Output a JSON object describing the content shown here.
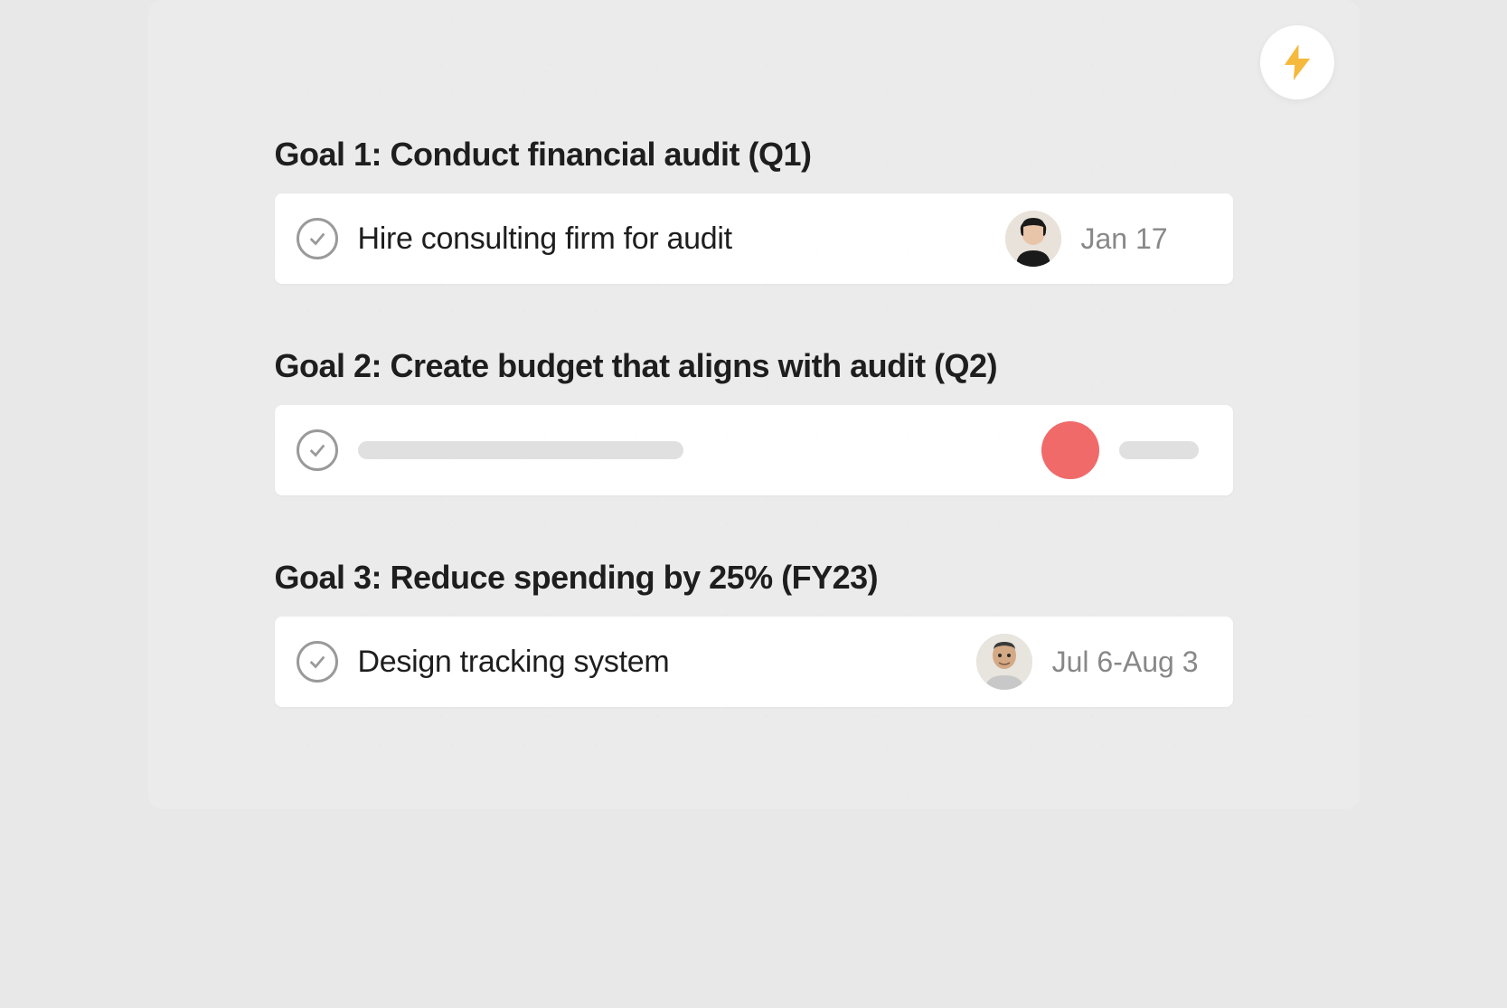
{
  "goals": [
    {
      "title": "Goal 1: Conduct financial audit (Q1)",
      "task": {
        "title": "Hire consulting firm for audit",
        "date": "Jan 17",
        "has_content": true,
        "status_color": null
      }
    },
    {
      "title": "Goal 2: Create budget that aligns with audit (Q2)",
      "task": {
        "title": "",
        "date": "",
        "has_content": false,
        "status_color": "#f06a6a"
      }
    },
    {
      "title": "Goal 3: Reduce spending by 25% (FY23)",
      "task": {
        "title": "Design tracking system",
        "date": "Jul 6-Aug 3",
        "has_content": true,
        "status_color": null
      }
    }
  ],
  "icons": {
    "lightning_color": "#f5b93d"
  }
}
